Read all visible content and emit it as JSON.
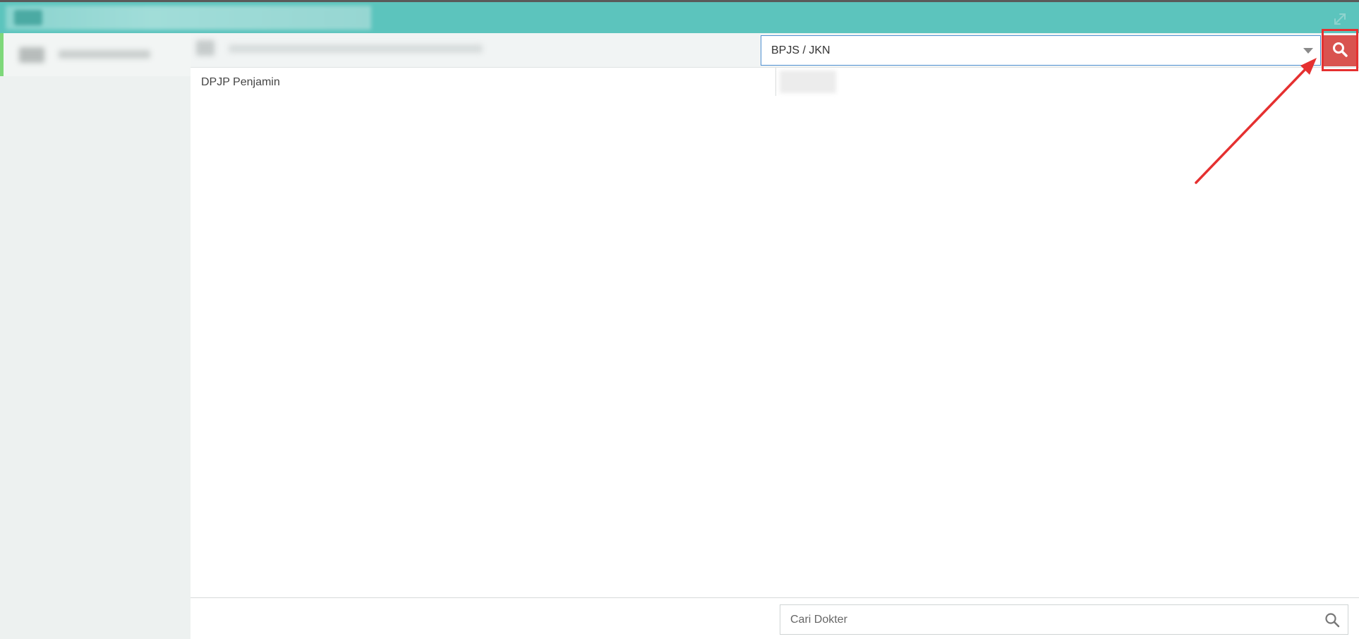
{
  "header": {
    "expand_icon": "expand-arrows-icon",
    "accent_color": "#5cc4bd"
  },
  "filter": {
    "penjamin_value": "BPJS / JKN",
    "search_button_icon": "search-icon",
    "search_button_color": "#d9534f"
  },
  "table": {
    "rows": [
      {
        "label": "DPJP Penjamin"
      }
    ]
  },
  "footer": {
    "search_placeholder": "Cari Dokter",
    "search_icon": "search-icon"
  },
  "annotation": {
    "color": "#e53030"
  }
}
